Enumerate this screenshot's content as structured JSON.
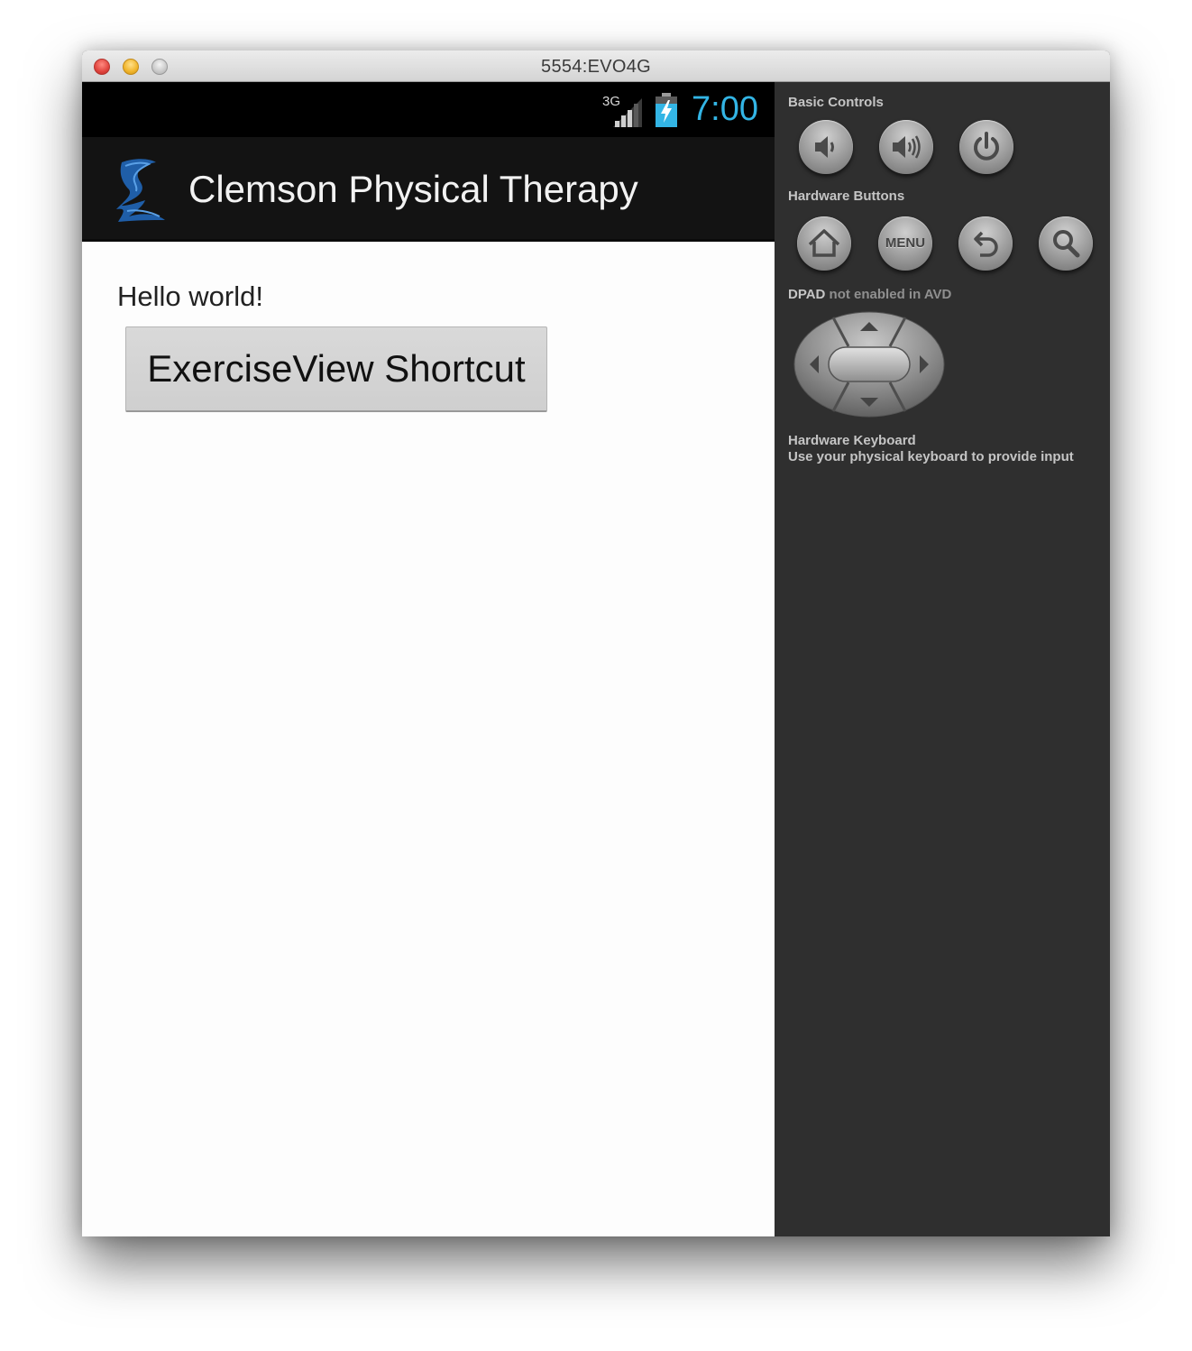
{
  "window": {
    "title": "5554:EVO4G"
  },
  "statusbar": {
    "network": "3G",
    "time": "7:00",
    "clock_color": "#33b5e5"
  },
  "actionbar": {
    "title": "Clemson Physical Therapy"
  },
  "content": {
    "hello": "Hello world!",
    "button_label": "ExerciseView Shortcut"
  },
  "controls": {
    "basic_label": "Basic Controls",
    "hardware_buttons_label": "Hardware Buttons",
    "menu_label": "MENU",
    "dpad_label_strong": "DPAD",
    "dpad_label_rest": " not enabled in AVD",
    "keyboard_label": "Hardware Keyboard",
    "keyboard_hint": "Use your physical keyboard to provide input"
  }
}
